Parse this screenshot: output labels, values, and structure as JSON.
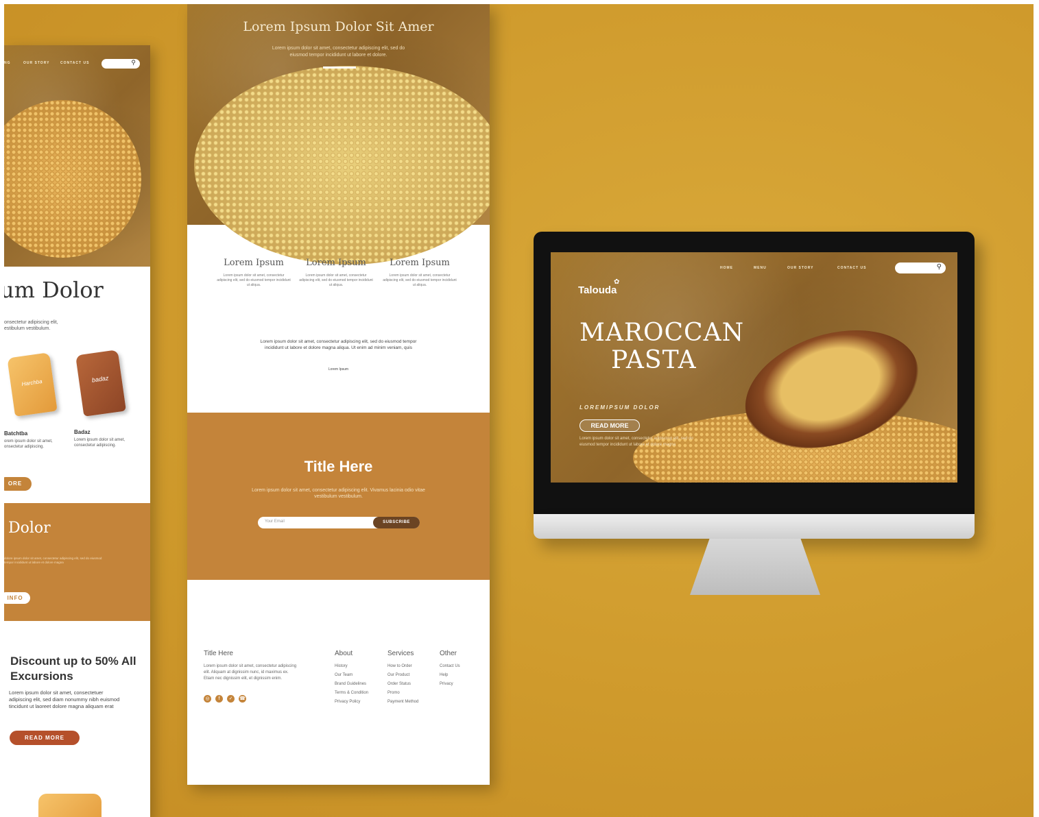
{
  "left_page": {
    "nav": [
      "NG",
      "OUR STORY",
      "CONTACT US"
    ],
    "heading": "um Dolor",
    "intro": "onsectetur adipiscing elit, estibulum vestibulum.",
    "products": [
      {
        "bag_label": "Harchba",
        "name": "Batchtba",
        "desc": "orem ipsum dolor sit amet, onsectetur adipiscing."
      },
      {
        "bag_label": "badaz",
        "name": "Badaz",
        "desc": "Lorem ipsum dolor sit amet, consectetur adipiscing."
      }
    ],
    "more_btn": "ORE",
    "band_title": "Dolor",
    "band_text": "dolore ipsum dolor sit amet, consectetur adipiscing elit, sed do eiusmod tempor incididunt ut labore et dolore magna",
    "info_btn": "INFO",
    "discount_title": "Discount up to 50% All Excursions",
    "discount_text": "Lorem ipsum dolor sit amet, consectetuer adipiscing elit, sed diam nonummy nibh euismod tincidunt ut laoreet dolore magna aliquam erat",
    "read_more": "READ MORE"
  },
  "center_page": {
    "hero_title": "Lorem Ipsum Dolor Sit Amer",
    "hero_sub": "Lorem ipsum dolor sit amet, consectetur adipiscing elit, sed do eiusmod tempor incididunt ut labore et dolore.",
    "columns": [
      {
        "title": "Lorem Ipsum",
        "text": "Lorem ipsum dolor sit amet, consectetur adipiscing elit, sed do eiusmod tempor incididunt ut aliqua."
      },
      {
        "title": "Lorem Ipsum",
        "text": "Lorem ipsum dolor sit amet, consectetur adipiscing elit, sed do eiusmod tempor incididunt ut aliqua."
      },
      {
        "title": "Lorem Ipsum",
        "text": "Lorem ipsum dolor sit amet, consectetur adipiscing elit, sed do eiusmod tempor incididunt ut aliqua."
      }
    ],
    "paragraph": "Lorem ipsum dolor sit amet, consectetur adipiscing elit, sed do eiusmod tempor incididunt ut labore et dolore magna aliqua. Ut enim ad minim veniam, quis",
    "mini_link": "Lorem Ipsum",
    "band_title": "Title Here",
    "band_text": "Lorem ipsum dolor sit amet, consectetur adipiscing elit. Vivamus lacinia odio vitae vestibulum vestibulum.",
    "email_placeholder": "Your Email",
    "subscribe": "SUBSCRIBE",
    "footer": {
      "title": "Title Here",
      "text": "Lorem ipsum dolor sit amet, consectetur adipiscing elit. Aliquam at dignissim nunc, id maximus ex. Etiam nec dignissim elit, et dignissim enim.",
      "about_title": "About",
      "about": [
        "History",
        "Our Team",
        "Brand Guidelines",
        "Terms & Condition",
        "Privacy Policy"
      ],
      "services_title": "Services",
      "services": [
        "How to Order",
        "Our Product",
        "Order Status",
        "Promo",
        "Payment Method"
      ],
      "other_title": "Other",
      "other": [
        "Contact Us",
        "Help",
        "Privacy"
      ]
    }
  },
  "monitor": {
    "nav": [
      "HOME",
      "MENU",
      "OUR STORY",
      "CONTACT US"
    ],
    "logo": "Talouda",
    "title_line1": "MAROCCAN",
    "title_line2": "PASTA",
    "subtitle": "LOREMIPSUM DOLOR",
    "read_more": "READ MORE",
    "text": "Lorem ipsum dolor sit amet, consectetur adipiscing elit, sed do eiusmod tempor incididunt ut labore et dolore magna"
  },
  "colors": {
    "background": "#cf9a2c",
    "accent": "#c4843a",
    "dark_button": "#6b4423"
  }
}
